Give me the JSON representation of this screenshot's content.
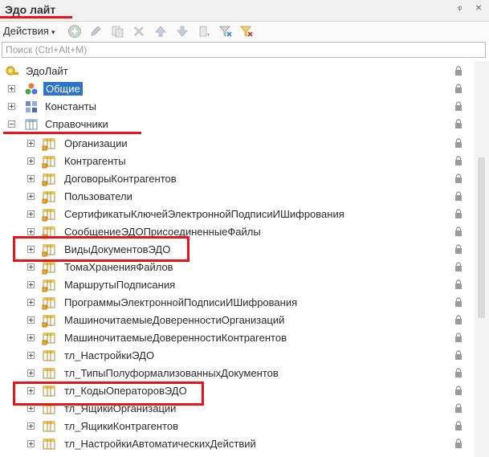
{
  "window": {
    "title": "Эдо лайт",
    "pin": "ᵠ",
    "close": "×"
  },
  "toolbar": {
    "actions_label": "Действия",
    "caret": "▾"
  },
  "search": {
    "placeholder": "Поиск (Ctrl+Alt+M)",
    "value": ""
  },
  "tree": {
    "root": "ЭдоЛайт",
    "groups": [
      {
        "label": "Общие",
        "selected": true,
        "expanded": false
      },
      {
        "label": "Константы",
        "expanded": false
      },
      {
        "label": "Справочники",
        "expanded": true
      }
    ],
    "catalogs": [
      "Организации",
      "Контрагенты",
      "ДоговорыКонтрагентов",
      "Пользователи",
      "СертификатыКлючейЭлектроннойПодписиИШифрования",
      "СообщениеЭДОПрисоединенныеФайлы",
      "ВидыДокументовЭДО",
      "ТомаХраненияФайлов",
      "МаршрутыПодписания",
      "ПрограммыЭлектроннойПодписиИШифрования",
      "МашиночитаемыеДоверенностиОрганизаций",
      "МашиночитаемыеДоверенностиКонтрагентов",
      "тл_НастройкиЭДО",
      "тл_ТипыПолуформализованныхДокументов",
      "тл_КодыОператоровЭДО",
      "тл_ЯщикиОрганизаций",
      "тл_ЯщикиКонтрагентов",
      "тл_НастройкиАвтоматическихДействий"
    ]
  },
  "colors": {
    "highlight": "#e8141c",
    "selection": "#2e74c8"
  }
}
